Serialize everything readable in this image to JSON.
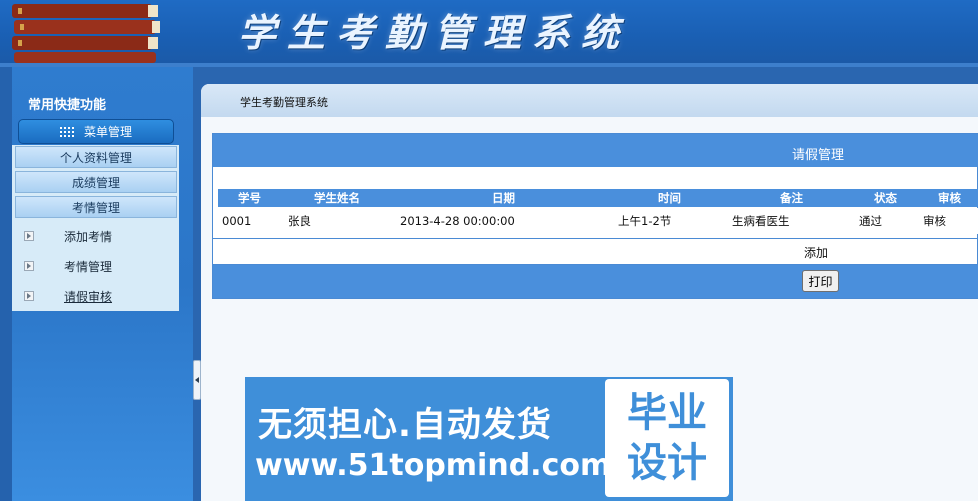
{
  "header": {
    "title": "学生考勤管理系统"
  },
  "sidebar": {
    "quick_title": "常用快捷功能",
    "menu_title": "菜单管理",
    "sections": [
      "个人资料管理",
      "成绩管理",
      "考情管理"
    ],
    "links": [
      "添加考情",
      "考情管理",
      "请假审核"
    ]
  },
  "breadcrumb": "学生考勤管理系统",
  "panel": {
    "title": "请假管理",
    "columns": [
      "学号",
      "学生姓名",
      "日期",
      "时间",
      "备注",
      "状态",
      "审核"
    ],
    "rows": [
      [
        "0001",
        "张良",
        "2013-4-28 00:00:00",
        "上午1-2节",
        "生病看医生",
        "通过",
        "审核"
      ]
    ],
    "add_label": "添加",
    "print_label": "打印"
  },
  "ad": {
    "line1": "无须担心.自动发货",
    "line2": "www.51topmind.com",
    "badge_top": "毕业",
    "badge_bottom": "设计"
  }
}
